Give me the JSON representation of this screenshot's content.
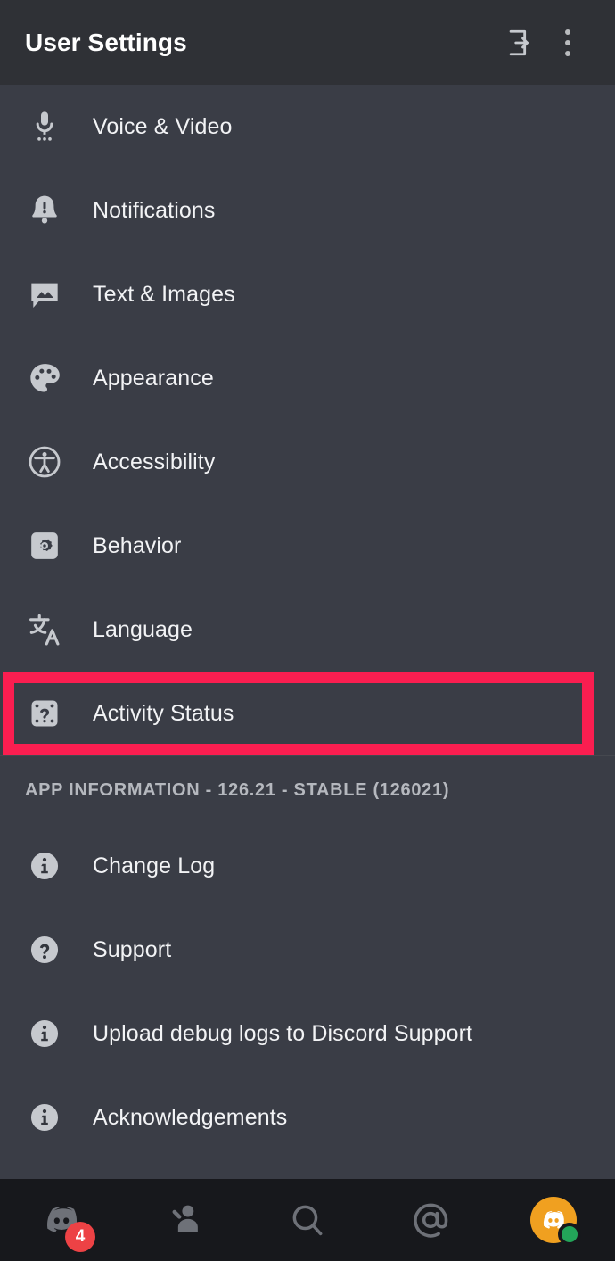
{
  "header": {
    "title": "User Settings",
    "logout_icon": "logout-icon",
    "overflow_icon": "kebab-menu-icon"
  },
  "settings": {
    "items": [
      {
        "label": "Voice & Video",
        "icon": "microphone-icon",
        "highlighted": false
      },
      {
        "label": "Notifications",
        "icon": "bell-alert-icon",
        "highlighted": false
      },
      {
        "label": "Text & Images",
        "icon": "chat-image-icon",
        "highlighted": false
      },
      {
        "label": "Appearance",
        "icon": "palette-icon",
        "highlighted": false
      },
      {
        "label": "Accessibility",
        "icon": "accessibility-icon",
        "highlighted": false
      },
      {
        "label": "Behavior",
        "icon": "gear-square-icon",
        "highlighted": false
      },
      {
        "label": "Language",
        "icon": "translate-icon",
        "highlighted": false
      },
      {
        "label": "Activity Status",
        "icon": "activity-status-icon",
        "highlighted": true
      }
    ]
  },
  "app_information": {
    "section_label": "APP INFORMATION - 126.21 - STABLE (126021)",
    "version": "126.21",
    "release_channel": "STABLE",
    "build": "126021",
    "items": [
      {
        "label": "Change Log",
        "icon": "info-circle-icon"
      },
      {
        "label": "Support",
        "icon": "question-circle-icon"
      },
      {
        "label": "Upload debug logs to Discord Support",
        "icon": "info-circle-icon"
      },
      {
        "label": "Acknowledgements",
        "icon": "info-circle-icon"
      }
    ]
  },
  "bottom_nav": {
    "items": [
      {
        "name": "servers",
        "icon": "discord-home-icon",
        "badge": "4"
      },
      {
        "name": "friends",
        "icon": "friends-icon",
        "badge": ""
      },
      {
        "name": "search",
        "icon": "search-icon",
        "badge": ""
      },
      {
        "name": "mentions",
        "icon": "mentions-at-icon",
        "badge": ""
      },
      {
        "name": "profile",
        "icon": "avatar-icon",
        "badge": ""
      }
    ],
    "status": "online"
  },
  "colors": {
    "header_bg": "#2F3136",
    "list_bg": "#3A3D46",
    "nav_bg": "#17181C",
    "highlight": "#FA1E50",
    "badge": "#ED4245",
    "online": "#23A559",
    "avatar": "#F0A020",
    "icon": "#C6C9CE",
    "text": "#F2F3F5",
    "muted_text": "#B5B8BE"
  }
}
